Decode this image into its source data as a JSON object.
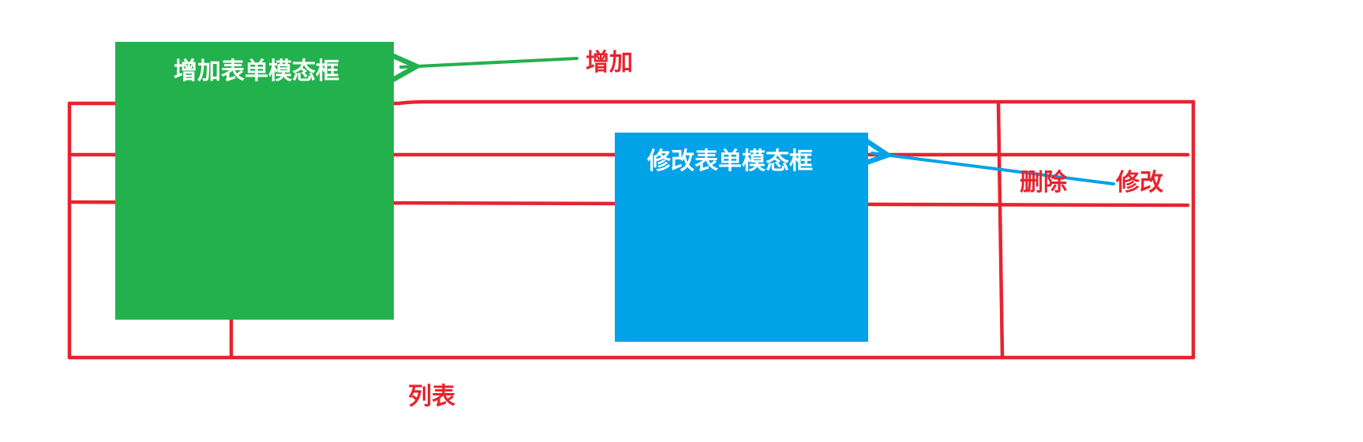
{
  "colors": {
    "line": "#e8232e",
    "add_modal": "#23b14d",
    "edit_modal": "#00a2e8",
    "label": "#e8232e",
    "modal_text": "#ffffff"
  },
  "add_modal": {
    "title": "增加表单模态框"
  },
  "edit_modal": {
    "title": "修改表单模态框"
  },
  "labels": {
    "add": "增加",
    "delete": "删除",
    "edit": "修改",
    "list": "列表"
  }
}
